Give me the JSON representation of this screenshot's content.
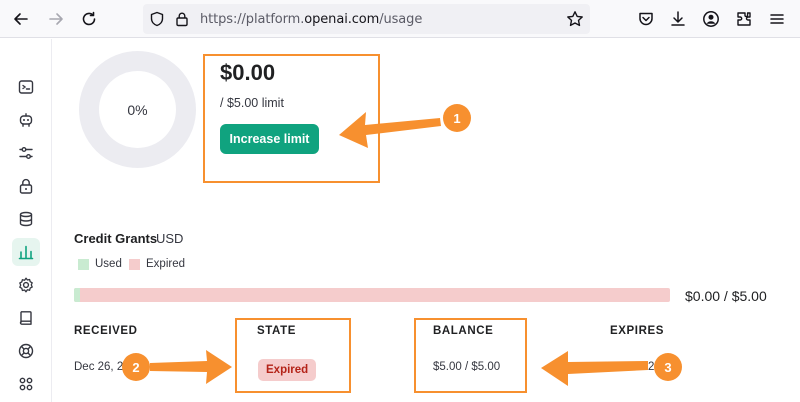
{
  "browser": {
    "url_prefix": "https://platform.",
    "url_domain": "openai.com",
    "url_path": "/usage"
  },
  "usage": {
    "donut_percent": "0%",
    "used_fraction": 0,
    "amount": "$0.00",
    "limit": "/ $5.00 limit",
    "increase_button": "Increase limit"
  },
  "credit_grants": {
    "title": "Credit Grants",
    "currency": "USD",
    "legend": {
      "used": "Used",
      "expired": "Expired"
    },
    "used_fraction": 0.01,
    "total": "$0.00 / $5.00",
    "columns": [
      "RECEIVED",
      "STATE",
      "BALANCE",
      "EXPIRES"
    ],
    "rows": [
      {
        "received": "Dec 26, 2",
        "state": "Expired",
        "balance": "$5.00 / $5.00",
        "expires": "2"
      }
    ]
  },
  "markers": [
    "1",
    "2",
    "3"
  ],
  "colors": {
    "accent": "#10a37f",
    "annotation": "#f7902f",
    "used": "#c9ebd1",
    "expired": "#f5cccc",
    "expired_text": "#b42318"
  }
}
